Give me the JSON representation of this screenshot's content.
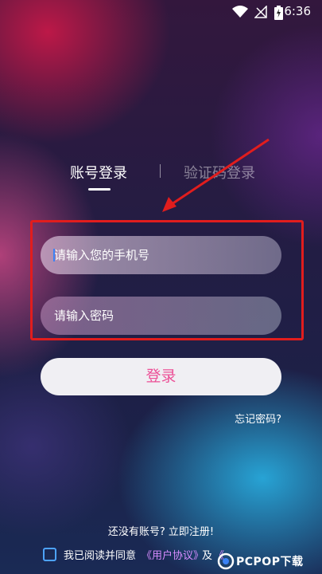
{
  "status": {
    "time": "6:36",
    "wifi_icon": "wifi-icon",
    "signal_icon": "no-signal-icon",
    "battery_icon": "battery-charging-icon"
  },
  "tabs": {
    "active": "账号登录",
    "inactive": "验证码登录"
  },
  "form": {
    "phone_placeholder": "请输入您的手机号",
    "password_placeholder": "请输入密码",
    "login_label": "登录",
    "forgot_label": "忘记密码?"
  },
  "register_prompt": "还没有账号? 立即注册!",
  "agreement": {
    "prefix": "我已阅读并同意",
    "user_agreement": "《用户协议》",
    "and": "及",
    "privacy": "《"
  },
  "watermark": {
    "text": "PCPOP下载"
  },
  "colors": {
    "accent_pink": "#ec4f96",
    "link_purple": "#d78cff",
    "annotation_red": "#e11d1d"
  }
}
